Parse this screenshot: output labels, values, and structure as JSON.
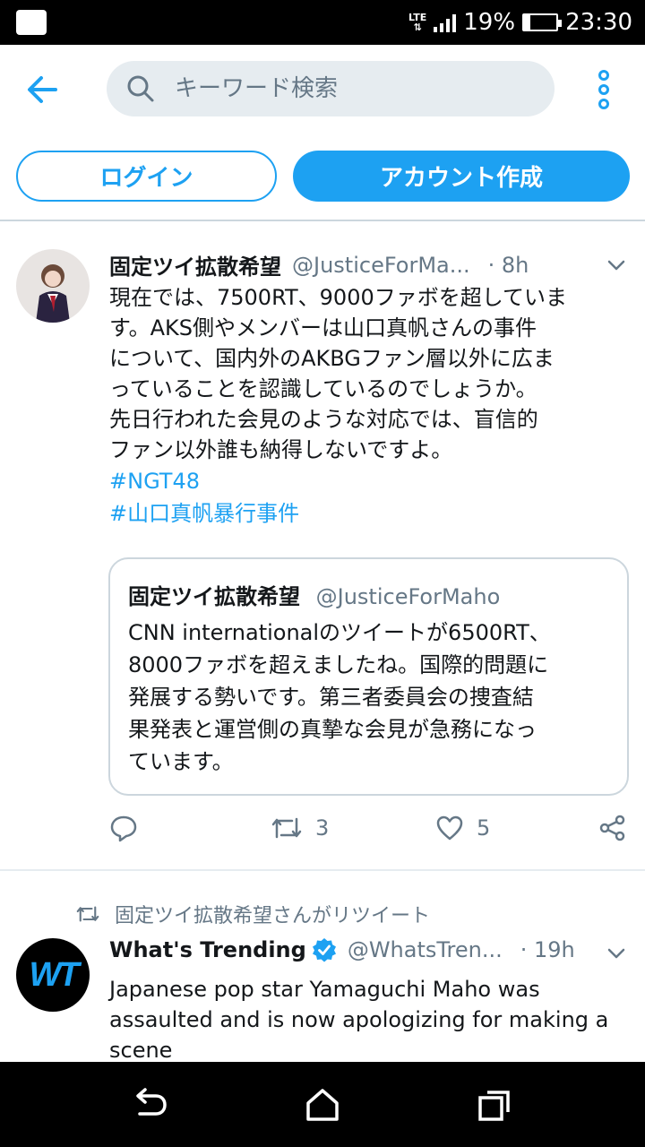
{
  "status_bar": {
    "network": "LTE",
    "battery_percent": "19%",
    "battery_level": 0.19,
    "time": "23:30"
  },
  "header": {
    "back_icon": "arrow-left-icon",
    "search_icon": "search-icon",
    "search_placeholder": "キーワード検索",
    "more_icon": "vertical-dots-icon"
  },
  "auth": {
    "login_label": "ログイン",
    "signup_label": "アカウント作成"
  },
  "colors": {
    "accent": "#1da1f2",
    "secondary_text": "#657786",
    "border": "#ccd6dd"
  },
  "tweet1": {
    "name": "固定ツイ拡散希望",
    "handle": "@JusticeForMa...",
    "time": "· 8h",
    "lines": [
      "現在では、7500RT、9000ファボを超していま",
      "す。AKS側やメンバーは山口真帆さんの事件",
      "について、国内外のAKBGファン層以外に広ま",
      "っていることを認識しているのでしょうか。",
      "先日行われた会見のような対応では、盲信的",
      "ファン以外誰も納得しないですよ。"
    ],
    "hashtags": [
      "#NGT48",
      "#山口真帆暴行事件"
    ],
    "quote": {
      "name": "固定ツイ拡散希望",
      "handle": "@JusticeForMaho",
      "lines": [
        "CNN internationalのツイートが6500RT、",
        "8000ファボを超えましたね。国際的問題に",
        "発展する勢いです。第三者委員会の捜査結",
        "果発表と運営側の真摯な会見が急務になっ",
        "ています。"
      ]
    },
    "actions": {
      "reply_icon": "reply-icon",
      "retweet_icon": "retweet-icon",
      "retweet_count": "3",
      "like_icon": "heart-icon",
      "like_count": "5",
      "share_icon": "share-icon"
    }
  },
  "tweet2": {
    "retweeted_by": "固定ツイ拡散希望さんがリツイート",
    "avatar_text": "WT",
    "name": "What's Trending",
    "handle": "@WhatsTren...",
    "time": "· 19h",
    "lines": [
      "Japanese pop star Yamaguchi Maho was",
      "assaulted and is now apologizing for making a",
      "scene"
    ]
  },
  "nav": {
    "back_icon": "android-back-icon",
    "home_icon": "android-home-icon",
    "recents_icon": "android-recents-icon"
  }
}
